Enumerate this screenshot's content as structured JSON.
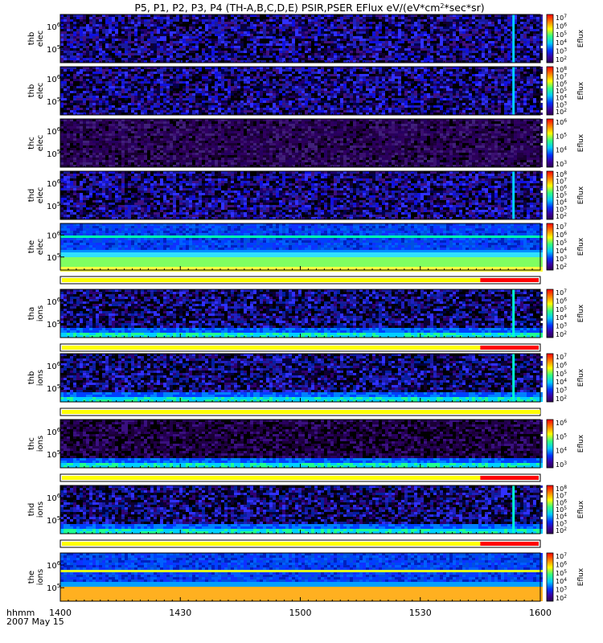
{
  "title": "P5, P1, P2, P3, P4 (TH-A,B,C,D,E) PSIR,PSER EFlux eV/(eV*cm",
  "title_sup": "2",
  "title_tail": "*sec*sr)",
  "time_axis_label": "hhmm",
  "date_label": "2007 May 15",
  "colors": {
    "spectrogram_background": "#000000",
    "flag_quality_good": "#ffff00",
    "flag_quality_bad": "#ff0000"
  },
  "chart_data": {
    "type": "heatmap",
    "x": {
      "label": "hhmm",
      "range": [
        "14:00",
        "16:00"
      ],
      "ticks": [
        "1400",
        "1430",
        "1500",
        "1530",
        "1600"
      ]
    },
    "colorbar_label": "Eflux",
    "panels": [
      {
        "label": "thb elec",
        "ylabel_top": "thb",
        "ylabel_bottom": "elec",
        "y_ticks": [
          "10",
          "10"
        ],
        "y_tick_exps": [
          "6",
          "5"
        ],
        "scale": "log",
        "colorbar_exps": [
          "7",
          "6",
          "5",
          "4",
          "3",
          "2"
        ],
        "colorbar_range": [
          100,
          10000000
        ],
        "flag_bar": false,
        "style": "sparse",
        "spike": true
      },
      {
        "label": "thb elec",
        "ylabel_top": "thb",
        "ylabel_bottom": "elec",
        "y_ticks": [
          "10",
          "10"
        ],
        "y_tick_exps": [
          "6",
          "5"
        ],
        "scale": "log",
        "colorbar_exps": [
          "8",
          "7",
          "6",
          "5",
          "4",
          "3",
          "2"
        ],
        "colorbar_range": [
          100,
          100000000
        ],
        "flag_bar": false,
        "style": "sparse",
        "spike": true
      },
      {
        "label": "thc elec",
        "ylabel_top": "thc",
        "ylabel_bottom": "elec",
        "y_ticks": [
          "10",
          "10"
        ],
        "y_tick_exps": [
          "6",
          "5"
        ],
        "scale": "log",
        "colorbar_exps": [
          "6",
          "5",
          "4",
          "3"
        ],
        "colorbar_range": [
          1000,
          1000000
        ],
        "flag_bar": false,
        "style": "purple",
        "spike": false
      },
      {
        "label": "thd elec",
        "ylabel_top": "thd",
        "ylabel_bottom": "elec",
        "y_ticks": [
          "10",
          "10"
        ],
        "y_tick_exps": [
          "6",
          "5"
        ],
        "scale": "log",
        "colorbar_exps": [
          "8",
          "7",
          "6",
          "5",
          "4",
          "3",
          "2"
        ],
        "colorbar_range": [
          100,
          100000000
        ],
        "flag_bar": false,
        "style": "sparse",
        "spike": true
      },
      {
        "label": "the elec",
        "ylabel_top": "the",
        "ylabel_bottom": "elec",
        "y_ticks": [
          "10",
          "10"
        ],
        "y_tick_exps": [
          "6",
          "5"
        ],
        "scale": "log",
        "colorbar_exps": [
          "7",
          "6",
          "5",
          "4",
          "3",
          "2"
        ],
        "colorbar_range": [
          100,
          10000000
        ],
        "flag_bar": true,
        "flag_red_from": "15:45",
        "style": "dense",
        "spike": false
      },
      {
        "label": "tha ions",
        "ylabel_top": "tha",
        "ylabel_bottom": "ions",
        "y_ticks": [
          "10",
          "10"
        ],
        "y_tick_exps": [
          "6",
          "5"
        ],
        "scale": "log",
        "colorbar_exps": [
          "7",
          "6",
          "5",
          "4",
          "3",
          "2"
        ],
        "colorbar_range": [
          100,
          10000000
        ],
        "flag_bar": true,
        "flag_red_from": "15:45",
        "style": "ion",
        "spike": true
      },
      {
        "label": "thb ions",
        "ylabel_top": "thb",
        "ylabel_bottom": "ions",
        "y_ticks": [
          "10",
          "10"
        ],
        "y_tick_exps": [
          "6",
          "5"
        ],
        "scale": "log",
        "colorbar_exps": [
          "7",
          "6",
          "5",
          "4",
          "3",
          "2"
        ],
        "colorbar_range": [
          100,
          10000000
        ],
        "flag_bar": true,
        "flag_red_from": null,
        "style": "ion",
        "spike": true
      },
      {
        "label": "thc ions",
        "ylabel_top": "thc",
        "ylabel_bottom": "ions",
        "y_ticks": [
          "10",
          "10"
        ],
        "y_tick_exps": [
          "6",
          "5"
        ],
        "scale": "log",
        "colorbar_exps": [
          "6",
          "5",
          "4",
          "3"
        ],
        "colorbar_range": [
          1000,
          1000000
        ],
        "flag_bar": true,
        "flag_red_from": "15:45",
        "style": "ionpurple",
        "spike": false
      },
      {
        "label": "thd ions",
        "ylabel_top": "thd",
        "ylabel_bottom": "ions",
        "y_ticks": [
          "10",
          "10"
        ],
        "y_tick_exps": [
          "6",
          "5"
        ],
        "scale": "log",
        "colorbar_exps": [
          "8",
          "7",
          "6",
          "5",
          "4",
          "3",
          "2"
        ],
        "colorbar_range": [
          100,
          100000000
        ],
        "flag_bar": true,
        "flag_red_from": "15:45",
        "style": "ion",
        "spike": true
      },
      {
        "label": "the ions",
        "ylabel_top": "the",
        "ylabel_bottom": "ions",
        "y_ticks": [
          "10",
          "10"
        ],
        "y_tick_exps": [
          "6",
          "5"
        ],
        "scale": "log",
        "colorbar_exps": [
          "7",
          "6",
          "5",
          "4",
          "3",
          "2"
        ],
        "colorbar_range": [
          100,
          10000000
        ],
        "flag_bar": false,
        "style": "denseion",
        "spike": false
      }
    ]
  }
}
